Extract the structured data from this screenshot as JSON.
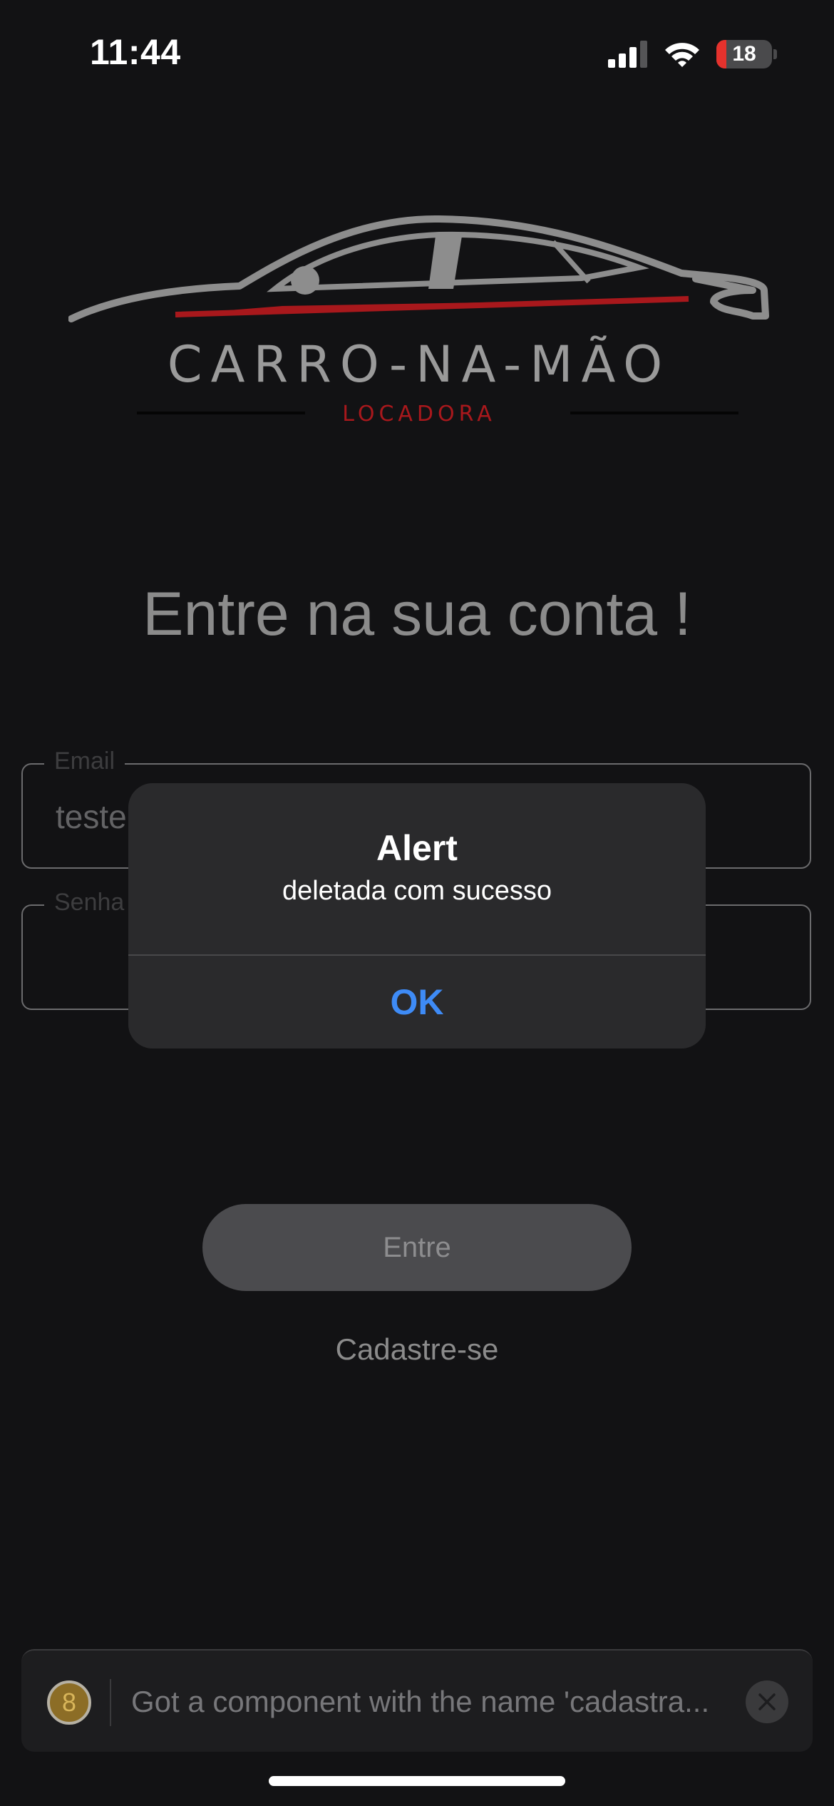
{
  "status_bar": {
    "time": "11:44",
    "battery_level": "18",
    "battery_fraction": 0.18,
    "icons": [
      "cellular-signal-icon",
      "wifi-icon",
      "battery-icon"
    ]
  },
  "logo": {
    "title": "CARRO-NA-MÃO",
    "subtitle": "LOCADORA",
    "icon": "car-logo-icon",
    "accent_color": "#a8181c"
  },
  "login": {
    "heading": "Entre na sua conta !",
    "email_label": "Email",
    "email_value": "teste",
    "password_label": "Senha",
    "password_value": "",
    "submit_label": "Entre",
    "signup_label": "Cadastre-se"
  },
  "alert": {
    "title": "Alert",
    "message": "deletada com sucesso",
    "ok_label": "OK",
    "ok_color": "#3e8bf6"
  },
  "log_banner": {
    "count": "8",
    "message": "Got a component with the name 'cadastra...",
    "close_icon": "close-icon"
  }
}
